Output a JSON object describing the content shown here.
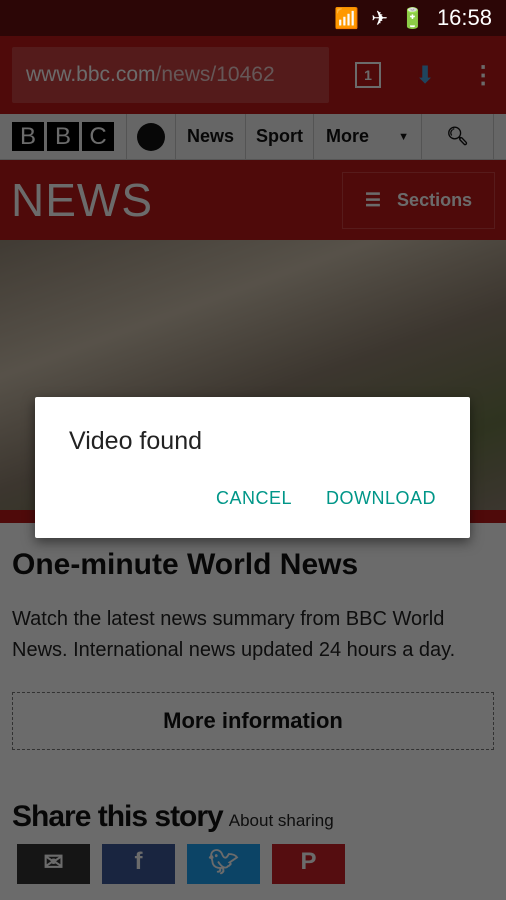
{
  "status": {
    "time": "16:58",
    "icons": [
      "wifi-icon",
      "airplane-icon",
      "battery-charging-icon"
    ]
  },
  "browser": {
    "url_host": "www.bbc.com",
    "url_path": "/news/10462",
    "tab_count": "1"
  },
  "bbc_nav": {
    "logo": [
      "B",
      "B",
      "C"
    ],
    "items": [
      "News",
      "Sport",
      "More"
    ]
  },
  "news_header": {
    "logo": "NEWS",
    "sections_label": "Sections"
  },
  "article": {
    "title": "One-minute World News",
    "summary": "Watch the latest news summary from BBC World News. International news updated 24 hours a day.",
    "more_info": "More information",
    "share_title": "Share this story",
    "about_sharing": "About sharing"
  },
  "share_buttons": [
    {
      "name": "email",
      "color": "#333333"
    },
    {
      "name": "facebook",
      "color": "#3b5998"
    },
    {
      "name": "twitter",
      "color": "#1da1f2"
    },
    {
      "name": "pinterest",
      "color": "#cb2027"
    }
  ],
  "dialog": {
    "title": "Video found",
    "cancel": "CANCEL",
    "download": "DOWNLOAD"
  },
  "colors": {
    "bbc_red": "#bb1919",
    "dialog_accent": "#009688"
  }
}
